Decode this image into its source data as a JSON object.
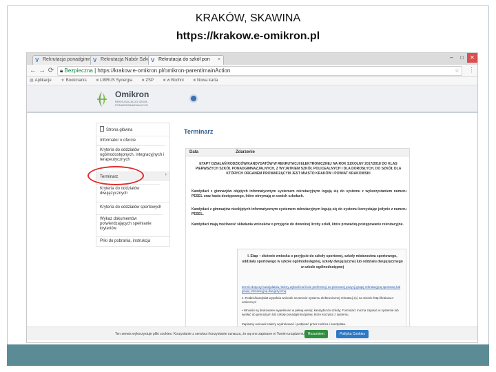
{
  "slide": {
    "title": "KRAKÓW, SKAWINA",
    "url": "https://krakow.e-omikron.pl"
  },
  "browser": {
    "tabs": [
      {
        "label": "Rekrutacja ponadgimnazjalna",
        "icon": "V",
        "close": "×"
      },
      {
        "label": "Rekrutacja Nabór Szkoły",
        "icon": "V",
        "close": "×"
      },
      {
        "label": "Rekrutacja do szkół pon",
        "icon": "V",
        "close": "×"
      }
    ],
    "window_buttons": [
      "–",
      "□",
      "✕"
    ],
    "address": {
      "secure_label": "Bezpieczna",
      "url": "https://krakow.e-omikron.pl/omikron-parent/mainAction",
      "back": "←",
      "forward": "→",
      "reload": "⟳",
      "star": "☆",
      "menu": "⋮"
    },
    "bookmarks": [
      {
        "label": "Aplikacje",
        "icon": "▦"
      },
      {
        "label": "Bookmarks",
        "icon": "★"
      },
      {
        "label": "LIBRUS Synergia",
        "icon": "■"
      },
      {
        "label": "ZSP",
        "icon": "■"
      },
      {
        "label": "w Bochni",
        "icon": "■"
      },
      {
        "label": "Nowa karta",
        "icon": "■"
      }
    ]
  },
  "site": {
    "logo_name": "Omikron",
    "logo_sub": "REKRUTACJA DO SZKÓŁ PONADGIMNAZJALNYCH",
    "colors": {
      "header_bg": "#eef0f3",
      "logo_green": "#6aa84f",
      "link": "#2a5db0",
      "highlight_ring": "#e12b2b"
    }
  },
  "sidebar": {
    "items": [
      {
        "label": "Strona główna",
        "icon": "document-icon"
      },
      {
        "label": "Informator o ofercie"
      },
      {
        "label": "Kryteria do oddziałów ogólnodostępnych, integracyjnych i terapeutycznych"
      },
      {
        "label": "Terminarz",
        "arrow": "›"
      },
      {
        "label": "Kryteria do oddziałów dwujęzycznych"
      },
      {
        "label": "Kryteria do oddziałów sportowych"
      },
      {
        "label": "Wykaz dokumentów potwierdzających spełnianie kryteriów"
      },
      {
        "label": "Pliki do pobrania, instrukcja"
      }
    ]
  },
  "content": {
    "title": "Terminarz",
    "columns": [
      "Data",
      "Zdarzenie"
    ],
    "heading": "ETAPY DZIAŁAŃ RODZICÓW/KANDYDATÓW W REKRUTACJI ELEKTRONICZNEJ NA ROK SZKOLNY 2017/2018 DO KLAS PIERWSZYCH SZKÓŁ PONADGIMNAZJALNYCH, Z WYJĄTKIEM SZKÓŁ POLICEALNYCH I DLA DOROSŁYCH, DO SZKÓŁ DLA KTÓRYCH ORGANEM PROWADZĄCYM JEST MIASTO KRAKÓW I POWIAT KRAKOWSKI",
    "paragraphs": [
      {
        "text": "Kandydaci z gimnazjów objętych informatycznym systemem rekrutacyjnym logują się do systemu z wykorzystaniem numeru PESEL oraz hasła dostępowego, które otrzymają w swoich szkołach.",
        "bold": true
      },
      {
        "text": "Kandydaci z gimnazjów nieobjętych informatycznym systemem rekrutacyjnym logują się do systemu korzystając jedynie z numeru PESEL.",
        "bold": true
      },
      {
        "text": "Kandydaci mają możliwość składania wniosków o przyjęcie do dowolnej liczby szkół, które prowadzą postępowanie rekrutacyjne.",
        "bold": true
      }
    ],
    "info_box": {
      "title": "I. Etap – złożenie wniosku o przyjęcie do szkoły sportowej, szkoły mistrzostwa sportowego, oddziału sportowego w szkole ogólnodostępnej, szkoły dwujęzycznej lub oddziału dwujęzycznego w szkole ogólnodostępnej",
      "lines": [
        "termin dotyczy kandydatów, którzy wybrali na liście preferencji na pierwszej pozycji grupę rekrutacyjną sportową lub grupę rekrutacyjną dwujęzyczną",
        "1. Rodzic/kandydat wypełnia wniosek na stronie systemu elektronicznej rekrutacji (1) na stronie http://krakow.e-omikron.pl",
        "• Wnioski są drukowane wypełnione w pełnej wersji; kandydat do szkoły; Formularz można zapisać w systemie lub wysłać do gimnazjum lub szkoły ponadgimnazjalnej, które korzysta z systemu.",
        "Zapisany wniosek należy wydrukować i podpisać przez rodzica i kandydata."
      ]
    }
  },
  "cookies": {
    "text": "Ten serwis wykorzystuje pliki cookies. Korzystanie z serwisu i korzystanie oznacza, że są one zapisane w Twoim urządzeniu.",
    "accept": "Rozumiem",
    "policy": "Polityka Cookies"
  }
}
